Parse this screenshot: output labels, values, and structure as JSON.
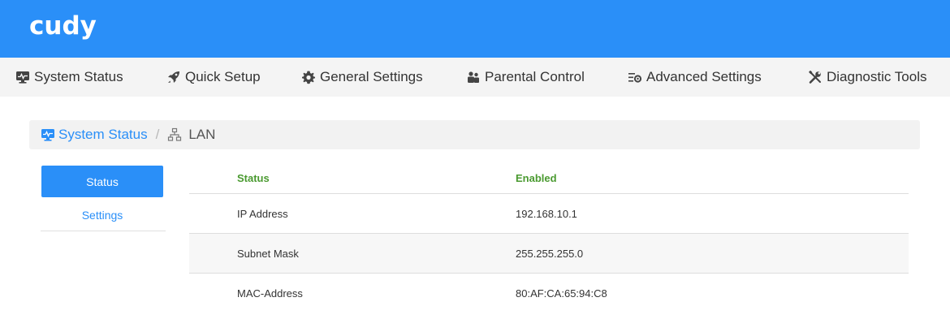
{
  "brand": {
    "logo_text": "cudy",
    "color": "#2a8ff8"
  },
  "nav": {
    "items": [
      {
        "label": "System Status",
        "icon": "monitor-icon"
      },
      {
        "label": "Quick Setup",
        "icon": "rocket-icon"
      },
      {
        "label": "General Settings",
        "icon": "gear-icon"
      },
      {
        "label": "Parental Control",
        "icon": "users-icon"
      },
      {
        "label": "Advanced Settings",
        "icon": "sliders-gear-icon"
      },
      {
        "label": "Diagnostic Tools",
        "icon": "tools-icon"
      }
    ]
  },
  "breadcrumb": {
    "home": "System Status",
    "separator": "/",
    "current": "LAN"
  },
  "sidebar": {
    "items": [
      {
        "label": "Status",
        "active": true
      },
      {
        "label": "Settings",
        "active": false
      }
    ]
  },
  "table": {
    "header": {
      "label": "Status",
      "value": "Enabled",
      "color": "#4a9a30"
    },
    "rows": [
      {
        "label": "IP Address",
        "value": "192.168.10.1"
      },
      {
        "label": "Subnet Mask",
        "value": "255.255.255.0"
      },
      {
        "label": "MAC-Address",
        "value": "80:AF:CA:65:94:C8"
      }
    ]
  }
}
